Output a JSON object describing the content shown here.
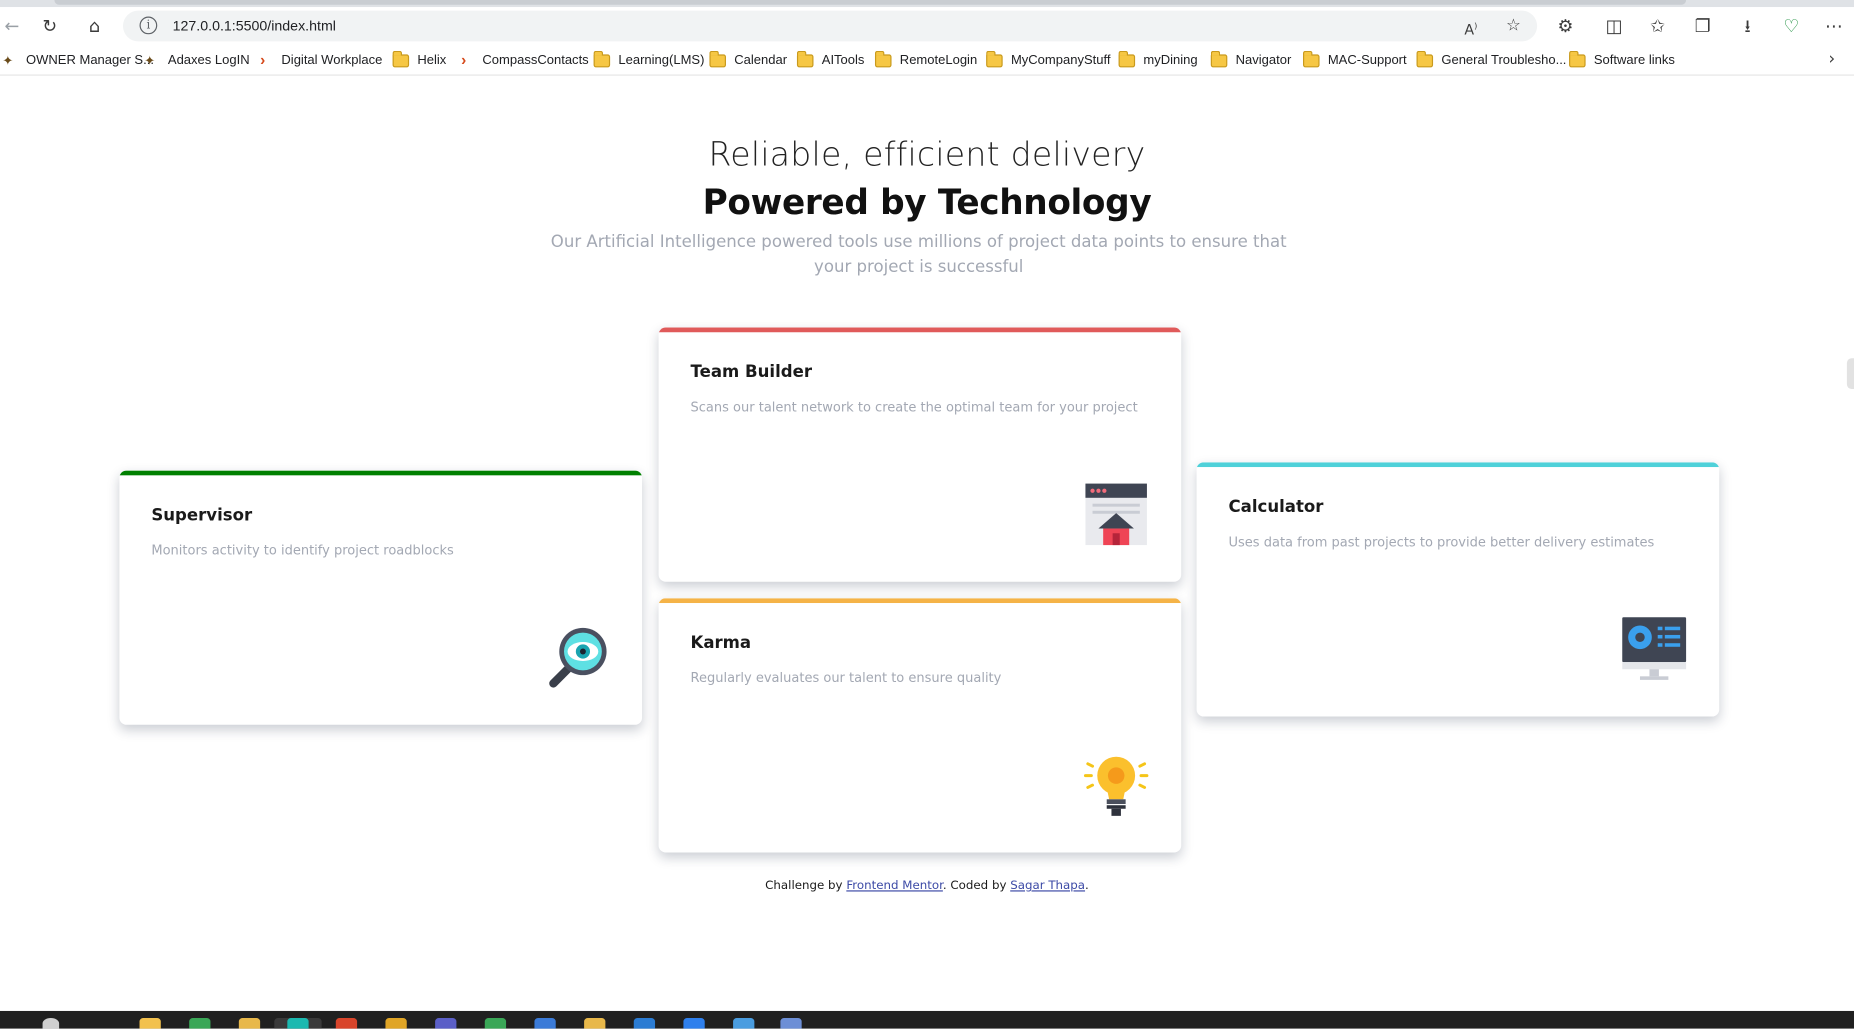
{
  "browser": {
    "url": "127.0.0.1:5500/index.html",
    "bookmarks": [
      {
        "label": "OWNER Manager S...",
        "icon": "bookmark-icon"
      },
      {
        "label": "Adaxes LogIN",
        "icon": "bookmark-icon"
      },
      {
        "label": "Digital Workplace",
        "icon": "chevron-logo-icon"
      },
      {
        "label": "Helix",
        "icon": "folder-icon"
      },
      {
        "label": "CompassContacts",
        "icon": "chevron-logo-icon"
      },
      {
        "label": "Learning(LMS)",
        "icon": "folder-icon"
      },
      {
        "label": "Calendar",
        "icon": "folder-icon"
      },
      {
        "label": "AITools",
        "icon": "folder-icon"
      },
      {
        "label": "RemoteLogin",
        "icon": "folder-icon"
      },
      {
        "label": "MyCompanyStuff",
        "icon": "folder-icon"
      },
      {
        "label": "myDining",
        "icon": "folder-icon"
      },
      {
        "label": "Navigator",
        "icon": "folder-icon"
      },
      {
        "label": "MAC-Support",
        "icon": "folder-icon"
      },
      {
        "label": "General Troublesho...",
        "icon": "folder-icon"
      },
      {
        "label": "Software links",
        "icon": "folder-icon"
      }
    ]
  },
  "hero": {
    "line1": "Reliable, efficient delivery",
    "line2": "Powered by Technology",
    "subtitle": "Our Artificial Intelligence powered tools use millions of project data points to ensure that your project is successful"
  },
  "cards": {
    "supervisor": {
      "title": "Supervisor",
      "desc": "Monitors activity to identify project roadblocks",
      "accent": "#008000",
      "icon": "magnifier-eye-icon"
    },
    "team_builder": {
      "title": "Team Builder",
      "desc": "Scans our talent network to create the optimal team for your project",
      "accent": "#e05a5a",
      "icon": "browser-house-icon"
    },
    "karma": {
      "title": "Karma",
      "desc": "Regularly evaluates our talent to ensure quality",
      "accent": "#f5b347",
      "icon": "lightbulb-icon"
    },
    "calculator": {
      "title": "Calculator",
      "desc": "Uses data from past projects to provide better delivery estimates",
      "accent": "#4fd1d9",
      "icon": "monitor-chart-icon"
    }
  },
  "footer": {
    "prefix": "Challenge by",
    "link1": "Frontend Mentor",
    "middle": ". Coded by",
    "link2": "Sagar Thapa",
    "suffix": "."
  }
}
